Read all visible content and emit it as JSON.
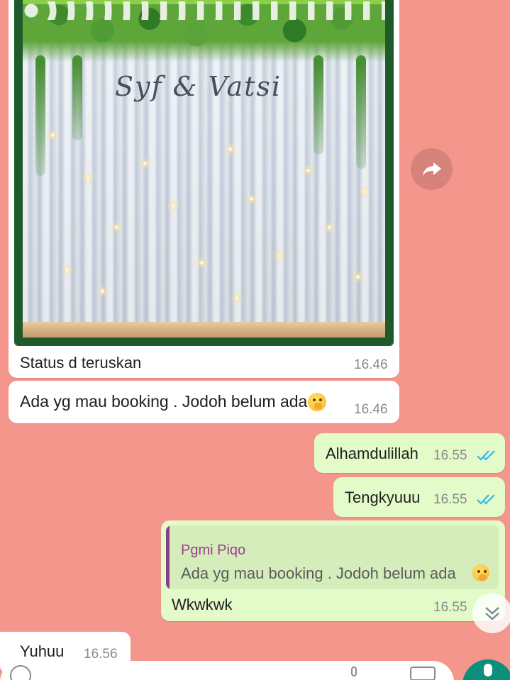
{
  "image_message": {
    "caption": "Status d teruskan",
    "time": "16.46",
    "image_sign_text": "Syf & Vatsi"
  },
  "messages": [
    {
      "direction": "in",
      "text": "Ada yg mau booking . Jodoh belum ada",
      "emoji": "face-with-hand-over-mouth",
      "time": "16.46"
    },
    {
      "direction": "out",
      "text": "Alhamdulillah",
      "time": "16.55",
      "status": "read"
    },
    {
      "direction": "out",
      "text": "Tengkyuuu",
      "time": "16.55",
      "status": "read"
    },
    {
      "direction": "out",
      "reply_to": {
        "author": "Pgmi Piqo",
        "text": "Ada yg mau booking . Jodoh belum ada"
      },
      "text": "Wkwkwk",
      "time": "16.55"
    },
    {
      "direction": "in",
      "text": "Yuhuu",
      "time": "16.56"
    }
  ],
  "colors": {
    "wallpaper": "#f4968c",
    "incoming_bubble": "#ffffff",
    "outgoing_bubble": "#e2fbc8",
    "read_ticks": "#34b7f1",
    "quote_author": "#9b3e8c",
    "send_button": "#0b8f7b"
  },
  "icons": {
    "forward": "forward-icon",
    "scroll_down": "double-chevron-down-icon",
    "read_receipt": "double-check-icon"
  }
}
